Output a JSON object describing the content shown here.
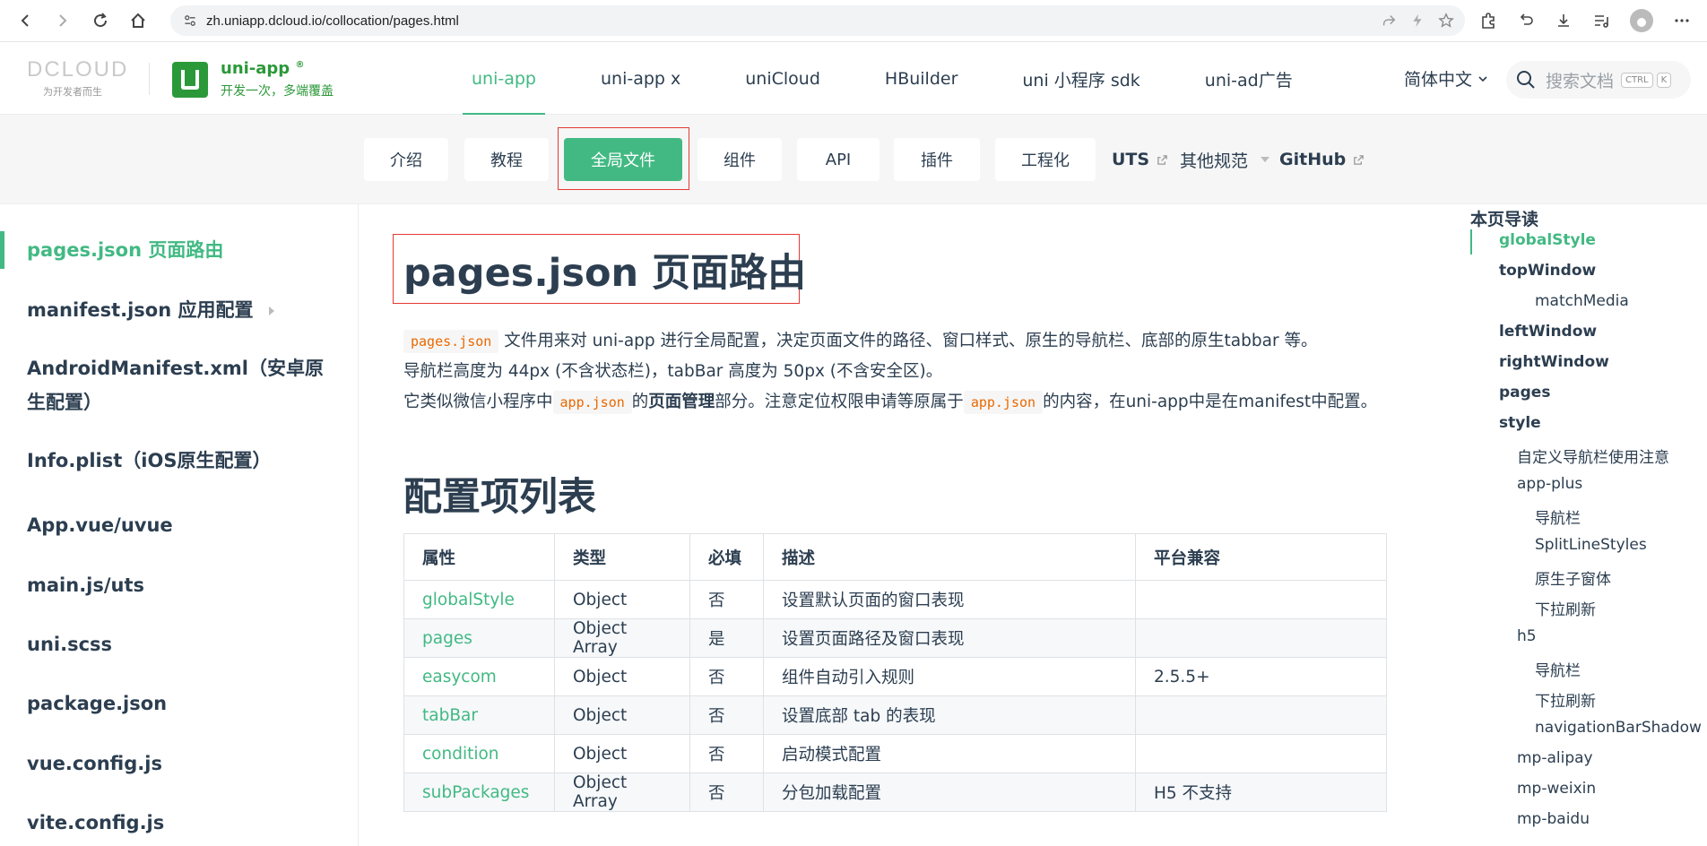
{
  "browser": {
    "url": "zh.uniapp.dcloud.io/collocation/pages.html"
  },
  "header": {
    "dcloud_logo": "DCLOUD",
    "dcloud_tagline": "为开发者而生",
    "product_title": "uni-app",
    "product_reg": "®",
    "product_slogan": "开发一次，多端覆盖",
    "nav": [
      "uni-app",
      "uni-app x",
      "uniCloud",
      "HBuilder",
      "uni 小程序 sdk",
      "uni-ad广告"
    ],
    "active_nav": "uni-app",
    "language": "简体中文",
    "search_placeholder": "搜索文档",
    "search_kbd_1": "CTRL",
    "search_kbd_2": "K"
  },
  "subnav": {
    "tabs": [
      "介绍",
      "教程",
      "全局文件",
      "组件",
      "API",
      "插件",
      "工程化"
    ],
    "active_tab": "全局文件",
    "uts": "UTS",
    "other": "其他规范",
    "github": "GitHub"
  },
  "sidebar": {
    "items": [
      "pages.json 页面路由",
      "manifest.json 应用配置",
      "AndroidManifest.xml（安卓原生配置）",
      "Info.plist（iOS原生配置）",
      "App.vue/uvue",
      "main.js/uts",
      "uni.scss",
      "package.json",
      "vue.config.js",
      "vite.config.js"
    ]
  },
  "main": {
    "title": "pages.json 页面路由",
    "intro_code": "pages.json",
    "intro_text": "文件用来对 uni-app 进行全局配置，决定页面文件的路径、窗口样式、原生的导航栏、底部的原生tabbar 等。",
    "line2": "导航栏高度为 44px (不含状态栏)，tabBar 高度为 50px (不含安全区)。",
    "line3_a": "它类似微信小程序中",
    "line3_code1": "app.json",
    "line3_b": "的",
    "line3_bold": "页面管理",
    "line3_c": "部分。注意定位权限申请等原属于",
    "line3_code2": "app.json",
    "line3_d": "的内容，在uni-app中是在manifest中配置。",
    "section_title": "配置项列表",
    "table": {
      "headers": [
        "属性",
        "类型",
        "必填",
        "描述",
        "平台兼容"
      ],
      "rows": [
        [
          "globalStyle",
          "Object",
          "否",
          "设置默认页面的窗口表现",
          ""
        ],
        [
          "pages",
          "Object Array",
          "是",
          "设置页面路径及窗口表现",
          ""
        ],
        [
          "easycom",
          "Object",
          "否",
          "组件自动引入规则",
          "2.5.5+"
        ],
        [
          "tabBar",
          "Object",
          "否",
          "设置底部 tab 的表现",
          ""
        ],
        [
          "condition",
          "Object",
          "否",
          "启动模式配置",
          ""
        ],
        [
          "subPackages",
          "Object Array",
          "否",
          "分包加载配置",
          "H5 不支持"
        ]
      ]
    }
  },
  "toc": {
    "heading": "本页导读",
    "items": [
      {
        "label": "globalStyle",
        "level": 1
      },
      {
        "label": "topWindow",
        "level": 1
      },
      {
        "label": "matchMedia",
        "level": 3
      },
      {
        "label": "leftWindow",
        "level": 1
      },
      {
        "label": "rightWindow",
        "level": 1
      },
      {
        "label": "pages",
        "level": 1
      },
      {
        "label": "style",
        "level": 1
      },
      {
        "label": "自定义导航栏使用注意",
        "level": 2
      },
      {
        "label": "app-plus",
        "level": 2
      },
      {
        "label": "导航栏",
        "level": 3
      },
      {
        "label": "SplitLineStyles",
        "level": 3
      },
      {
        "label": "原生子窗体",
        "level": 3
      },
      {
        "label": "下拉刷新",
        "level": 3
      },
      {
        "label": "h5",
        "level": 2
      },
      {
        "label": "导航栏",
        "level": 3
      },
      {
        "label": "下拉刷新",
        "level": 3
      },
      {
        "label": "navigationBarShadow",
        "level": 3
      },
      {
        "label": "mp-alipay",
        "level": 2
      },
      {
        "label": "mp-weixin",
        "level": 2
      },
      {
        "label": "mp-baidu",
        "level": 2
      }
    ]
  },
  "colors": {
    "accent": "#42b983",
    "brand_green": "#2b9939",
    "highlight_box": "#e53935"
  }
}
